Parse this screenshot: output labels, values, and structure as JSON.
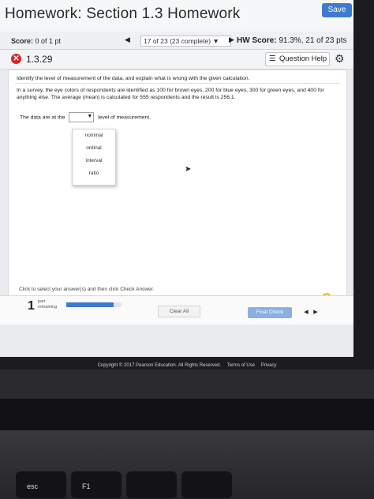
{
  "header": {
    "title": "Homework: Section 1.3 Homework",
    "save_label": "Save"
  },
  "scorebar": {
    "score_label": "Score:",
    "score_value": "0 of 1 pt",
    "progress_text": "17 of 23 (23 complete) ▼",
    "hw_score_label": "HW Score:",
    "hw_score_value": "91.3%, 21 of 23 pts"
  },
  "question": {
    "number": "1.3.29",
    "help_label": "Question Help",
    "instruction": "Identify the level of measurement of the data, and explain what is wrong with the given calculation.",
    "problem": "In a survey, the eye colors of respondents are identified as 100 for brown eyes, 200 for blue eyes, 300 for green eyes, and 400 for anything else. The average (mean) is calculated for 555 respondents and the result is 256.1.",
    "answer_prefix": "The data are at the",
    "answer_suffix": "level of measurement.",
    "dropdown_options": [
      "nominal",
      "ordinal",
      "interval",
      "ratio"
    ]
  },
  "footer": {
    "click_message": "Click to select your answer(s) and then click Check Answer.",
    "parts_count": "1",
    "parts_label_1": "part",
    "parts_label_2": "remaining",
    "parts_progress": 0.85,
    "clear_label": "Clear All",
    "final_check_label": "Final Check"
  },
  "page_footer": {
    "copyright": "Copyright © 2017 Pearson Education. All Rights Reserved.",
    "terms": "Terms of Use",
    "privacy": "Privacy"
  },
  "keyboard": {
    "esc": "esc",
    "f1": "F1"
  },
  "colors": {
    "accent": "#3f7ad1",
    "error": "#d8232a",
    "help": "#f2b630"
  }
}
